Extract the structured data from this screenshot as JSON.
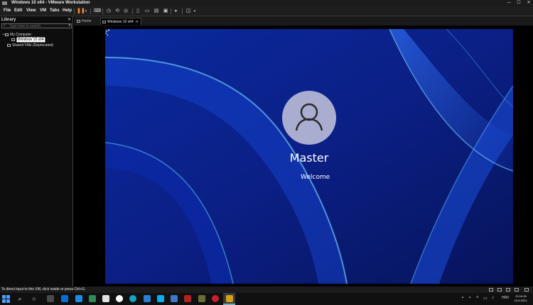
{
  "window": {
    "title": "Windows 10 x64 - VMware Workstation",
    "controls": {
      "minimize": "—",
      "maximize": "☐",
      "close": "✕"
    }
  },
  "menu": [
    "File",
    "Edit",
    "View",
    "VM",
    "Tabs",
    "Help"
  ],
  "toolbar": {
    "icons": [
      "pause-icon",
      "dropdown-icon",
      "send-ctrl-alt-del-icon",
      "snapshot-icon",
      "revert-snapshot-icon",
      "snapshot-manager-icon",
      "library-toggle-icon",
      "thumbnail-icon",
      "tabs-icon",
      "console-icon",
      "fullscreen-icon",
      "unity-icon"
    ]
  },
  "library": {
    "title": "Library",
    "close": "✕",
    "search_placeholder": "Type here to search",
    "tree": [
      {
        "label": "My Computer",
        "level": 0,
        "expanded": true
      },
      {
        "label": "Windows 10 x64",
        "level": 1,
        "selected": true
      },
      {
        "label": "Shared VMs (Deprecated)",
        "level": 0
      }
    ]
  },
  "tabs": [
    {
      "label": "Home",
      "active": false
    },
    {
      "label": "Windows 10 x64",
      "active": true,
      "close": "✕"
    }
  ],
  "vm": {
    "username": "Master",
    "status": "Welcome",
    "colors": {
      "background": "#0a2a9a",
      "avatar": "#a9aed1"
    }
  },
  "statusbar": {
    "message": "To direct input to this VM, click inside or press Ctrl+G."
  },
  "taskbar": {
    "apps": [
      "search-icon",
      "task-view-icon",
      "store-icon",
      "mail-icon",
      "vmware-icon",
      "explorer-icon",
      "edge-icon",
      "chrome-icon",
      "skype-icon",
      "remote-desktop-icon",
      "photos-icon",
      "filezilla-icon",
      "hyper-v-icon",
      "opera-icon",
      "app-icon",
      "vmware-workstation-icon"
    ],
    "tray_lang": "HRV",
    "time": "22:10:39",
    "date": "15.6.2021."
  }
}
